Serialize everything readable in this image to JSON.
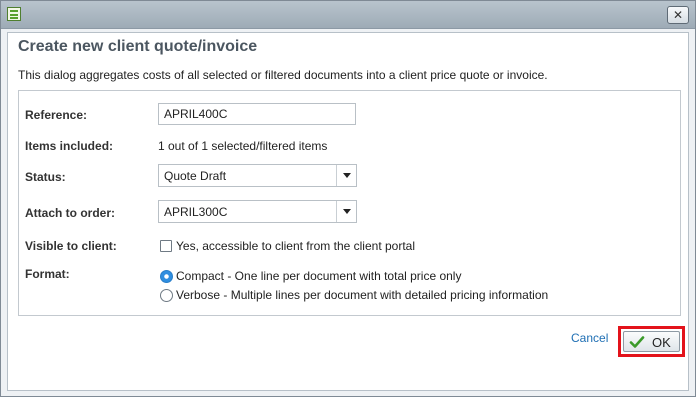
{
  "window": {
    "close_glyph": "✕",
    "title_icon": "form-icon"
  },
  "dialog": {
    "title": "Create new client quote/invoice",
    "description": "This dialog aggregates costs of all selected or filtered documents into a client price quote or invoice."
  },
  "form": {
    "reference": {
      "label": "Reference:",
      "value": "APRIL400C"
    },
    "items_included": {
      "label": "Items included:",
      "value": "1 out of 1 selected/filtered items"
    },
    "status": {
      "label": "Status:",
      "value": "Quote Draft"
    },
    "attach_to_order": {
      "label": "Attach to order:",
      "value": "APRIL300C"
    },
    "visible_to_client": {
      "label": "Visible to client:",
      "option": "Yes, accessible to client from the client portal",
      "checked": false
    },
    "format": {
      "label": "Format:",
      "options": [
        {
          "label": "Compact - One line per document with total price only",
          "selected": true
        },
        {
          "label": "Verbose - Multiple lines per document with detailed pricing information",
          "selected": false
        }
      ]
    }
  },
  "actions": {
    "cancel_label": "Cancel",
    "ok_label": "OK"
  },
  "colors": {
    "accent": "#1f6fb4",
    "highlight": "#e3131b",
    "radio_selected": "#2f8ee0"
  }
}
